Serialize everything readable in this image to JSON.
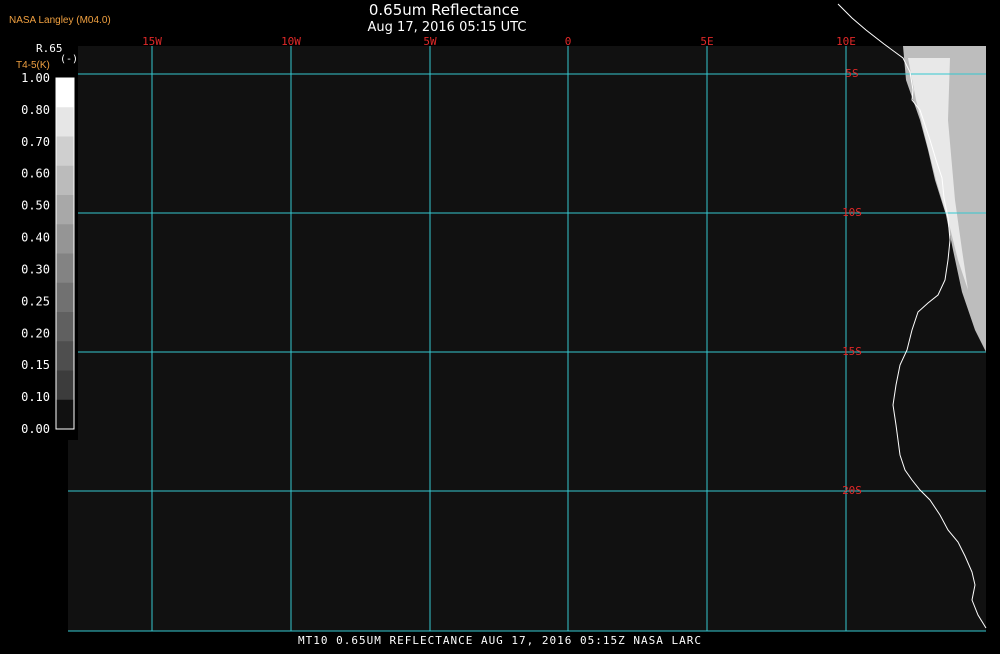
{
  "map": {
    "title": "0.65um Reflectance",
    "timestamp": "Aug 17, 2016 05:15 UTC",
    "credit": "NASA Langley (M04.0)",
    "footer": "MT10  0.65UM REFLECTANCE   AUG 17, 2016 05:15Z   NASA LARC",
    "colors": {
      "background": "#000000",
      "ocean": "#111111",
      "grid": "#35c8d0",
      "grid_label": "#e02828",
      "coast": "#ffffff"
    },
    "longitude_labels": [
      "15W",
      "10W",
      "5W",
      "0",
      "5E",
      "10E"
    ],
    "latitude_labels": [
      "5S",
      "10S",
      "15S",
      "20S"
    ]
  },
  "legend": {
    "variable": "R.65",
    "subvariable": "T4-5(K)",
    "units": "(-)",
    "ticks": [
      "1.00",
      "0.80",
      "0.70",
      "0.60",
      "0.50",
      "0.40",
      "0.30",
      "0.25",
      "0.20",
      "0.15",
      "0.10",
      "0.00"
    ],
    "swatches": [
      "#ffffff",
      "#e6e6e6",
      "#cfcfcf",
      "#bbbbbb",
      "#a8a8a8",
      "#959595",
      "#838383",
      "#717171",
      "#606060",
      "#4e4e4e",
      "#3c3c3c",
      "#111111"
    ]
  }
}
